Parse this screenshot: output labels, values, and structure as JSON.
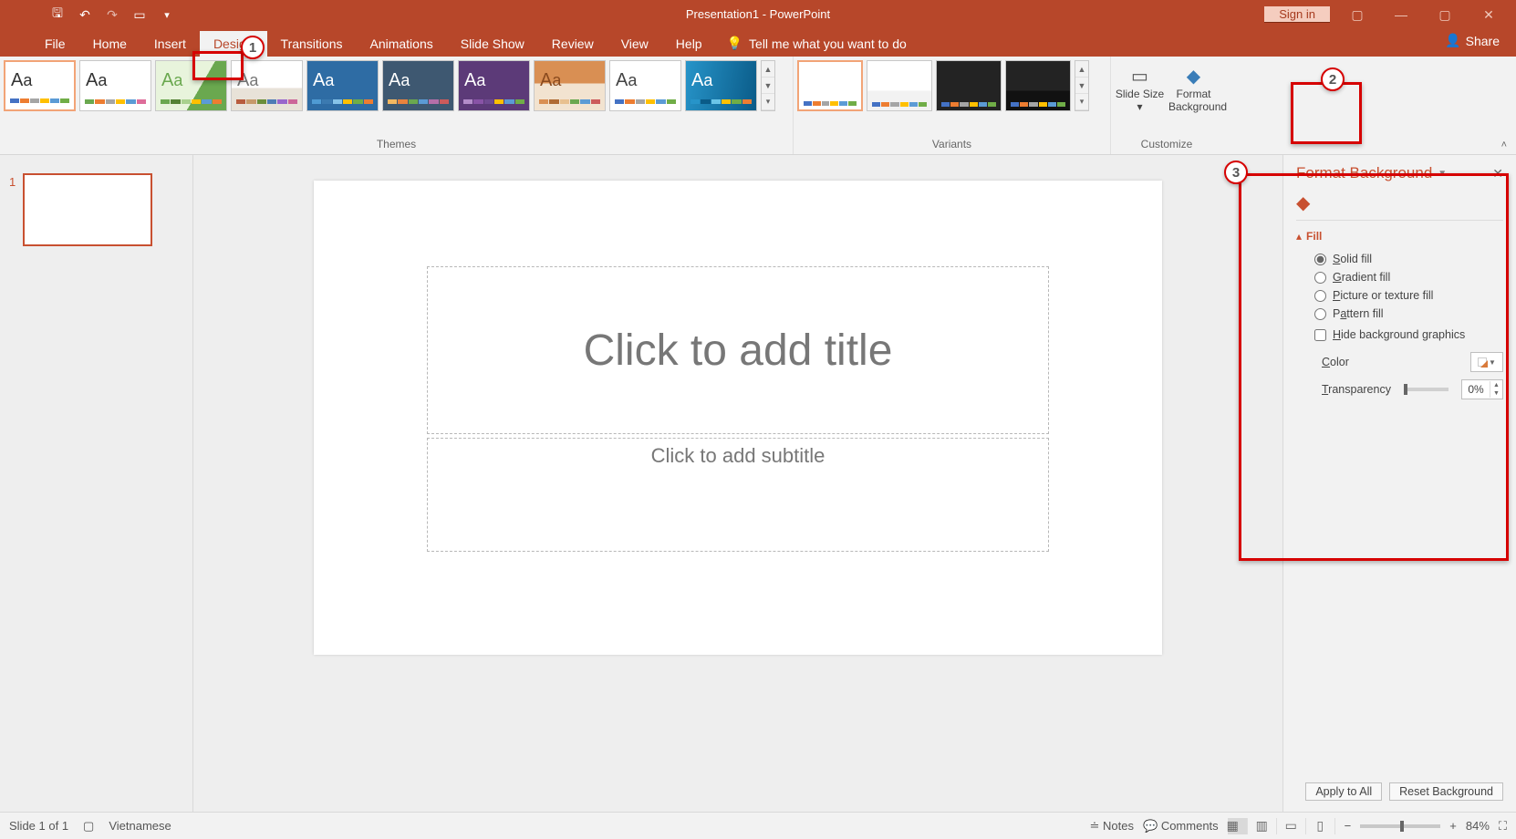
{
  "titlebar": {
    "title": "Presentation1 - PowerPoint",
    "signin": "Sign in"
  },
  "tabs": {
    "file": "File",
    "home": "Home",
    "insert": "Insert",
    "design": "Design",
    "transitions": "Transitions",
    "animations": "Animations",
    "slideshow": "Slide Show",
    "review": "Review",
    "view": "View",
    "help": "Help",
    "tellme": "Tell me what you want to do",
    "share": "Share"
  },
  "ribbon": {
    "themes_label": "Themes",
    "variants_label": "Variants",
    "customize_label": "Customize",
    "slide_size": "Slide Size ▾",
    "format_bg": "Format Background"
  },
  "slide": {
    "title_placeholder": "Click to add title",
    "subtitle_placeholder": "Click to add subtitle"
  },
  "pane": {
    "title": "Format Background",
    "section_fill": "Fill",
    "solid": "Solid fill",
    "gradient": "Gradient fill",
    "picture": "Picture or texture fill",
    "pattern": "Pattern fill",
    "hide": "Hide background graphics",
    "color": "Color",
    "transparency": "Transparency",
    "trans_val": "0%",
    "apply": "Apply to All",
    "reset": "Reset Background"
  },
  "status": {
    "slide": "Slide 1 of 1",
    "lang": "Vietnamese",
    "notes": "Notes",
    "comments": "Comments",
    "zoom": "84%"
  },
  "thumb": {
    "num": "1"
  },
  "callouts": {
    "c1": "1",
    "c2": "2",
    "c3": "3"
  }
}
